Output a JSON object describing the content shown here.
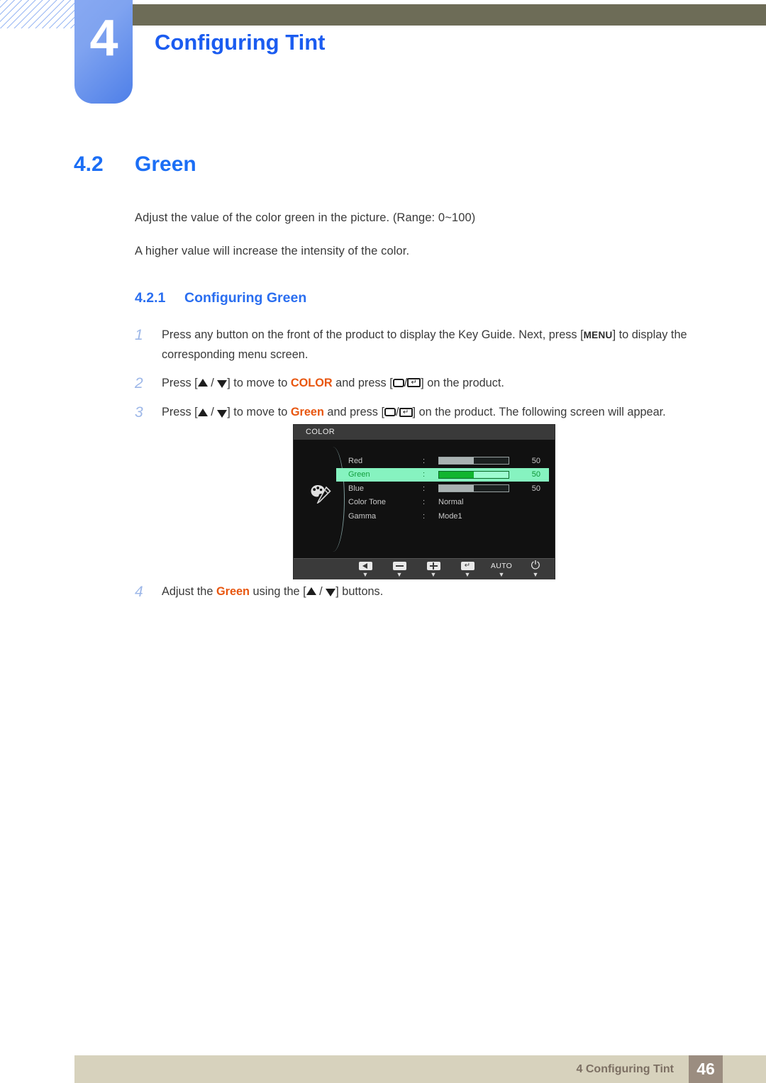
{
  "header": {
    "chapter_number": "4",
    "chapter_title": "Configuring Tint"
  },
  "section": {
    "number": "4.2",
    "title": "Green"
  },
  "intro": {
    "paragraph_1": "Adjust the value of the color green in the picture. (Range: 0~100)",
    "paragraph_2": "A higher value will increase the intensity of the color."
  },
  "subsection": {
    "number": "4.2.1",
    "title": "Configuring Green"
  },
  "steps": [
    {
      "index": "1",
      "part_1": "Press any button on the front of the product to display the Key Guide. Next, press [",
      "menu_key": "MENU",
      "part_2": "] to display the corresponding menu screen."
    },
    {
      "index": "2",
      "part_1": "Press [",
      "part_2": "] to move to ",
      "keyword": "COLOR",
      "part_3": " and press [",
      "part_4": "] on the product."
    },
    {
      "index": "3",
      "part_1": "Press [",
      "part_2": "] to move to ",
      "keyword": "Green",
      "part_3": " and press [",
      "part_4": "] on the product. The following screen will appear."
    },
    {
      "index": "4",
      "part_1": "Adjust the ",
      "keyword": "Green",
      "part_2": " using the [",
      "part_3": "] buttons."
    }
  ],
  "osd": {
    "title": "COLOR",
    "palette_icon": "palette-icon",
    "rows": [
      {
        "label": "Red",
        "colon": ":",
        "type": "slider",
        "value": "50",
        "fill_percent": 50,
        "highlighted": false
      },
      {
        "label": "Green",
        "colon": ":",
        "type": "slider",
        "value": "50",
        "fill_percent": 50,
        "highlighted": true
      },
      {
        "label": "Blue",
        "colon": ":",
        "type": "slider",
        "value": "50",
        "fill_percent": 50,
        "highlighted": false
      },
      {
        "label": "Color Tone",
        "colon": ":",
        "type": "text",
        "value": "Normal",
        "highlighted": false
      },
      {
        "label": "Gamma",
        "colon": ":",
        "type": "text",
        "value": "Mode1",
        "highlighted": false
      }
    ],
    "keys": [
      {
        "icon": "left-arrow-icon",
        "label": "",
        "caret": "▼"
      },
      {
        "icon": "minus-icon",
        "label": "",
        "caret": "▼"
      },
      {
        "icon": "plus-icon",
        "label": "",
        "caret": "▼"
      },
      {
        "icon": "enter-icon",
        "label": "",
        "caret": "▼"
      },
      {
        "icon": "auto-text",
        "label": "AUTO",
        "caret": "▼"
      },
      {
        "icon": "power-icon",
        "label": "⏻",
        "caret": "▼"
      }
    ]
  },
  "footer": {
    "text": "4 Configuring Tint",
    "page_number": "46"
  },
  "colors": {
    "accent_blue": "#1b5cf0",
    "section_blue": "#1b6ef5",
    "keyword_orange": "#e8560f",
    "olive_bar": "#6d6c57",
    "footer_bar": "#d7d2bd",
    "footer_page_bg": "#9b8d80",
    "osd_highlight": "#86f3c0",
    "osd_green_fill": "#11b52f"
  }
}
